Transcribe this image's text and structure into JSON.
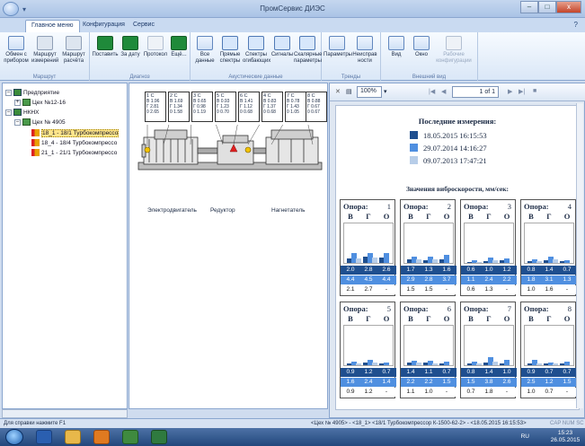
{
  "window": {
    "title": "ПромСервис ДИЭС",
    "buttons": {
      "minimize": "–",
      "maximize": "□",
      "close": "x"
    }
  },
  "ribbon_tabs": [
    "Главное меню",
    "Конфигурация",
    "Сервис"
  ],
  "ribbon": {
    "groups": [
      {
        "label": "Маршрут",
        "buttons": [
          "Обмен с прибором",
          "Маршрут измерений",
          "Маршрут расчёта"
        ]
      },
      {
        "label": "Диагноз",
        "buttons": [
          "Поставить",
          "За дату",
          "Протокол",
          "Ещё..."
        ]
      },
      {
        "label": "Акустические данные",
        "buttons": [
          "Все данные",
          "Прямые спектры",
          "Спектры огибающих",
          "Сигналы",
          "Скалярные параметры"
        ]
      },
      {
        "label": "Тренды",
        "buttons": [
          "Параметры",
          "Неисправ ности"
        ]
      },
      {
        "label": "Внешний вид",
        "buttons": [
          "Вид",
          "Окно",
          "Рабочие конфигурации"
        ]
      }
    ]
  },
  "tree": {
    "items": [
      {
        "label": "Предприятие",
        "expander": "–"
      },
      {
        "label": "Цех №12-16",
        "expander": "+"
      },
      {
        "label": "НКНХ",
        "expander": "–"
      },
      {
        "label": "Цех № 4905",
        "expander": "–"
      },
      {
        "label": "18_1 - 18/1 Турбокомпрессо",
        "selected": true
      },
      {
        "label": "18_4 - 18/4 Турбокомпрессо"
      },
      {
        "label": "21_1 - 21/1 Турбокомпрессо"
      }
    ]
  },
  "schema": {
    "boxes": [
      {
        "head": "1 C",
        "l1": "В 1.96",
        "l2": "Г 2.81",
        "l3": "0 2.65"
      },
      {
        "head": "2 C",
        "l1": "В 1.69",
        "l2": "Г 1.34",
        "l3": "0 1.58"
      },
      {
        "head": "3 C",
        "l1": "В 0.65",
        "l2": "Г 0.98",
        "l3": "0 1.19"
      },
      {
        "head": "5 C",
        "l1": "В 0.93",
        "l2": "Г 1.23",
        "l3": "0 0.70"
      },
      {
        "head": "6 C",
        "l1": "В 1.41",
        "l2": "Г 1.12",
        "l3": "0 0.68"
      },
      {
        "head": "4 C",
        "l1": "В 0.83",
        "l2": "Г 1.37",
        "l3": "0 0.68"
      },
      {
        "head": "7 C",
        "l1": "В 0.78",
        "l2": "Г 1.43",
        "l3": "0 1.05"
      },
      {
        "head": "8 C",
        "l1": "В 0.88",
        "l2": "Г 0.67",
        "l3": "0 0.67"
      }
    ],
    "labels": {
      "motor": "Электродвигатель",
      "reducer": "Редуктор",
      "compressor": "Нагнетатель"
    }
  },
  "report_toolbar": {
    "zoom": "100%",
    "page": "1",
    "of": "of 1"
  },
  "report": {
    "title": "Последние измерения:",
    "measurements": [
      {
        "date": "18.05.2015  16:15:53",
        "color": "#1f4f8f"
      },
      {
        "date": "29.07.2014  14:16:27",
        "color": "#4f8fe0"
      },
      {
        "date": "09.07.2013  17:47:21",
        "color": "#b7cde8"
      }
    ],
    "vib_title": "Значения виброскорости, мм/сек:",
    "support_label": "Опора:",
    "axes": [
      "В",
      "Г",
      "О"
    ],
    "colors": {
      "dark": "#1f4f8f",
      "mid": "#4f8fe0",
      "light": "#b7cde8"
    },
    "supports": [
      {
        "num": "1",
        "r1": [
          "2.0",
          "2.8",
          "2.6"
        ],
        "r2": [
          "4.4",
          "4.5",
          "4.4"
        ],
        "r3": [
          "2.1",
          "2.7",
          "-"
        ]
      },
      {
        "num": "2",
        "r1": [
          "1.7",
          "1.3",
          "1.6"
        ],
        "r2": [
          "2.9",
          "2.8",
          "3.7"
        ],
        "r3": [
          "1.5",
          "1.5",
          "-"
        ]
      },
      {
        "num": "3",
        "r1": [
          "0.6",
          "1.0",
          "1.2"
        ],
        "r2": [
          "1.1",
          "2.4",
          "2.2"
        ],
        "r3": [
          "0.6",
          "1.3",
          "-"
        ]
      },
      {
        "num": "4",
        "r1": [
          "0.8",
          "1.4",
          "0.7"
        ],
        "r2": [
          "1.8",
          "3.1",
          "1.3"
        ],
        "r3": [
          "1.0",
          "1.6",
          "-"
        ]
      },
      {
        "num": "5",
        "r1": [
          "0.9",
          "1.2",
          "0.7"
        ],
        "r2": [
          "1.6",
          "2.4",
          "1.4"
        ],
        "r3": [
          "0.9",
          "1.2",
          "-"
        ]
      },
      {
        "num": "6",
        "r1": [
          "1.4",
          "1.1",
          "0.7"
        ],
        "r2": [
          "2.2",
          "2.2",
          "1.5"
        ],
        "r3": [
          "1.1",
          "1.0",
          "-"
        ]
      },
      {
        "num": "7",
        "r1": [
          "0.8",
          "1.4",
          "1.0"
        ],
        "r2": [
          "1.5",
          "3.8",
          "2.6"
        ],
        "r3": [
          "0.7",
          "1.8",
          "-"
        ]
      },
      {
        "num": "8",
        "r1": [
          "0.9",
          "0.7",
          "0.7"
        ],
        "r2": [
          "2.5",
          "1.2",
          "1.5"
        ],
        "r3": [
          "1.0",
          "0.7",
          "-"
        ]
      }
    ]
  },
  "status": {
    "left": "Для справки нажмите F1",
    "path": "<Цех № 4905> - <18_1> <18/1 Турбокомпрессор К-1500-62-2> - <18.05.2015 16:15:53>",
    "indicators": "CAP NUM SC"
  },
  "taskbar": {
    "lang": "RU",
    "time": "15:23",
    "date": "26.05.2015"
  }
}
